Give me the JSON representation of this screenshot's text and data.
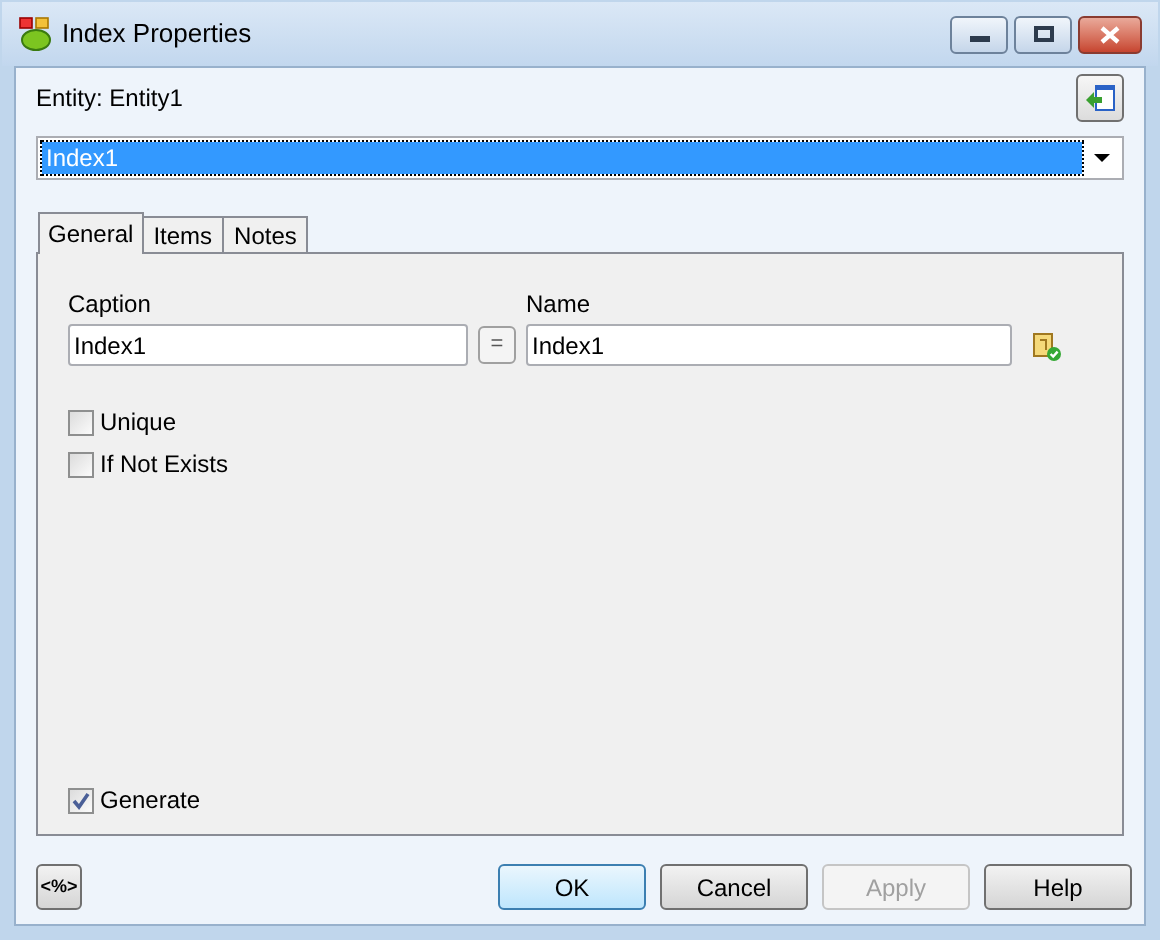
{
  "window": {
    "title": "Index Properties"
  },
  "entity_label": "Entity: Entity1",
  "index_select": {
    "value": "Index1"
  },
  "tabs": [
    {
      "label": "General",
      "selected": true
    },
    {
      "label": "Items",
      "selected": false
    },
    {
      "label": "Notes",
      "selected": false
    }
  ],
  "caption": {
    "label": "Caption",
    "value": "Index1"
  },
  "equal_button": "=",
  "name": {
    "label": "Name",
    "value": "Index1"
  },
  "checkboxes": [
    {
      "label": "Unique",
      "checked": false
    },
    {
      "label": "If Not Exists",
      "checked": false
    }
  ],
  "generate": {
    "label": "Generate",
    "checked": true
  },
  "template_button": "<%>",
  "buttons": [
    {
      "label": "OK",
      "kind": "default",
      "disabled": false
    },
    {
      "label": "Cancel",
      "kind": "normal",
      "disabled": false
    },
    {
      "label": "Apply",
      "kind": "normal",
      "disabled": true
    },
    {
      "label": "Help",
      "kind": "normal",
      "disabled": false
    }
  ]
}
